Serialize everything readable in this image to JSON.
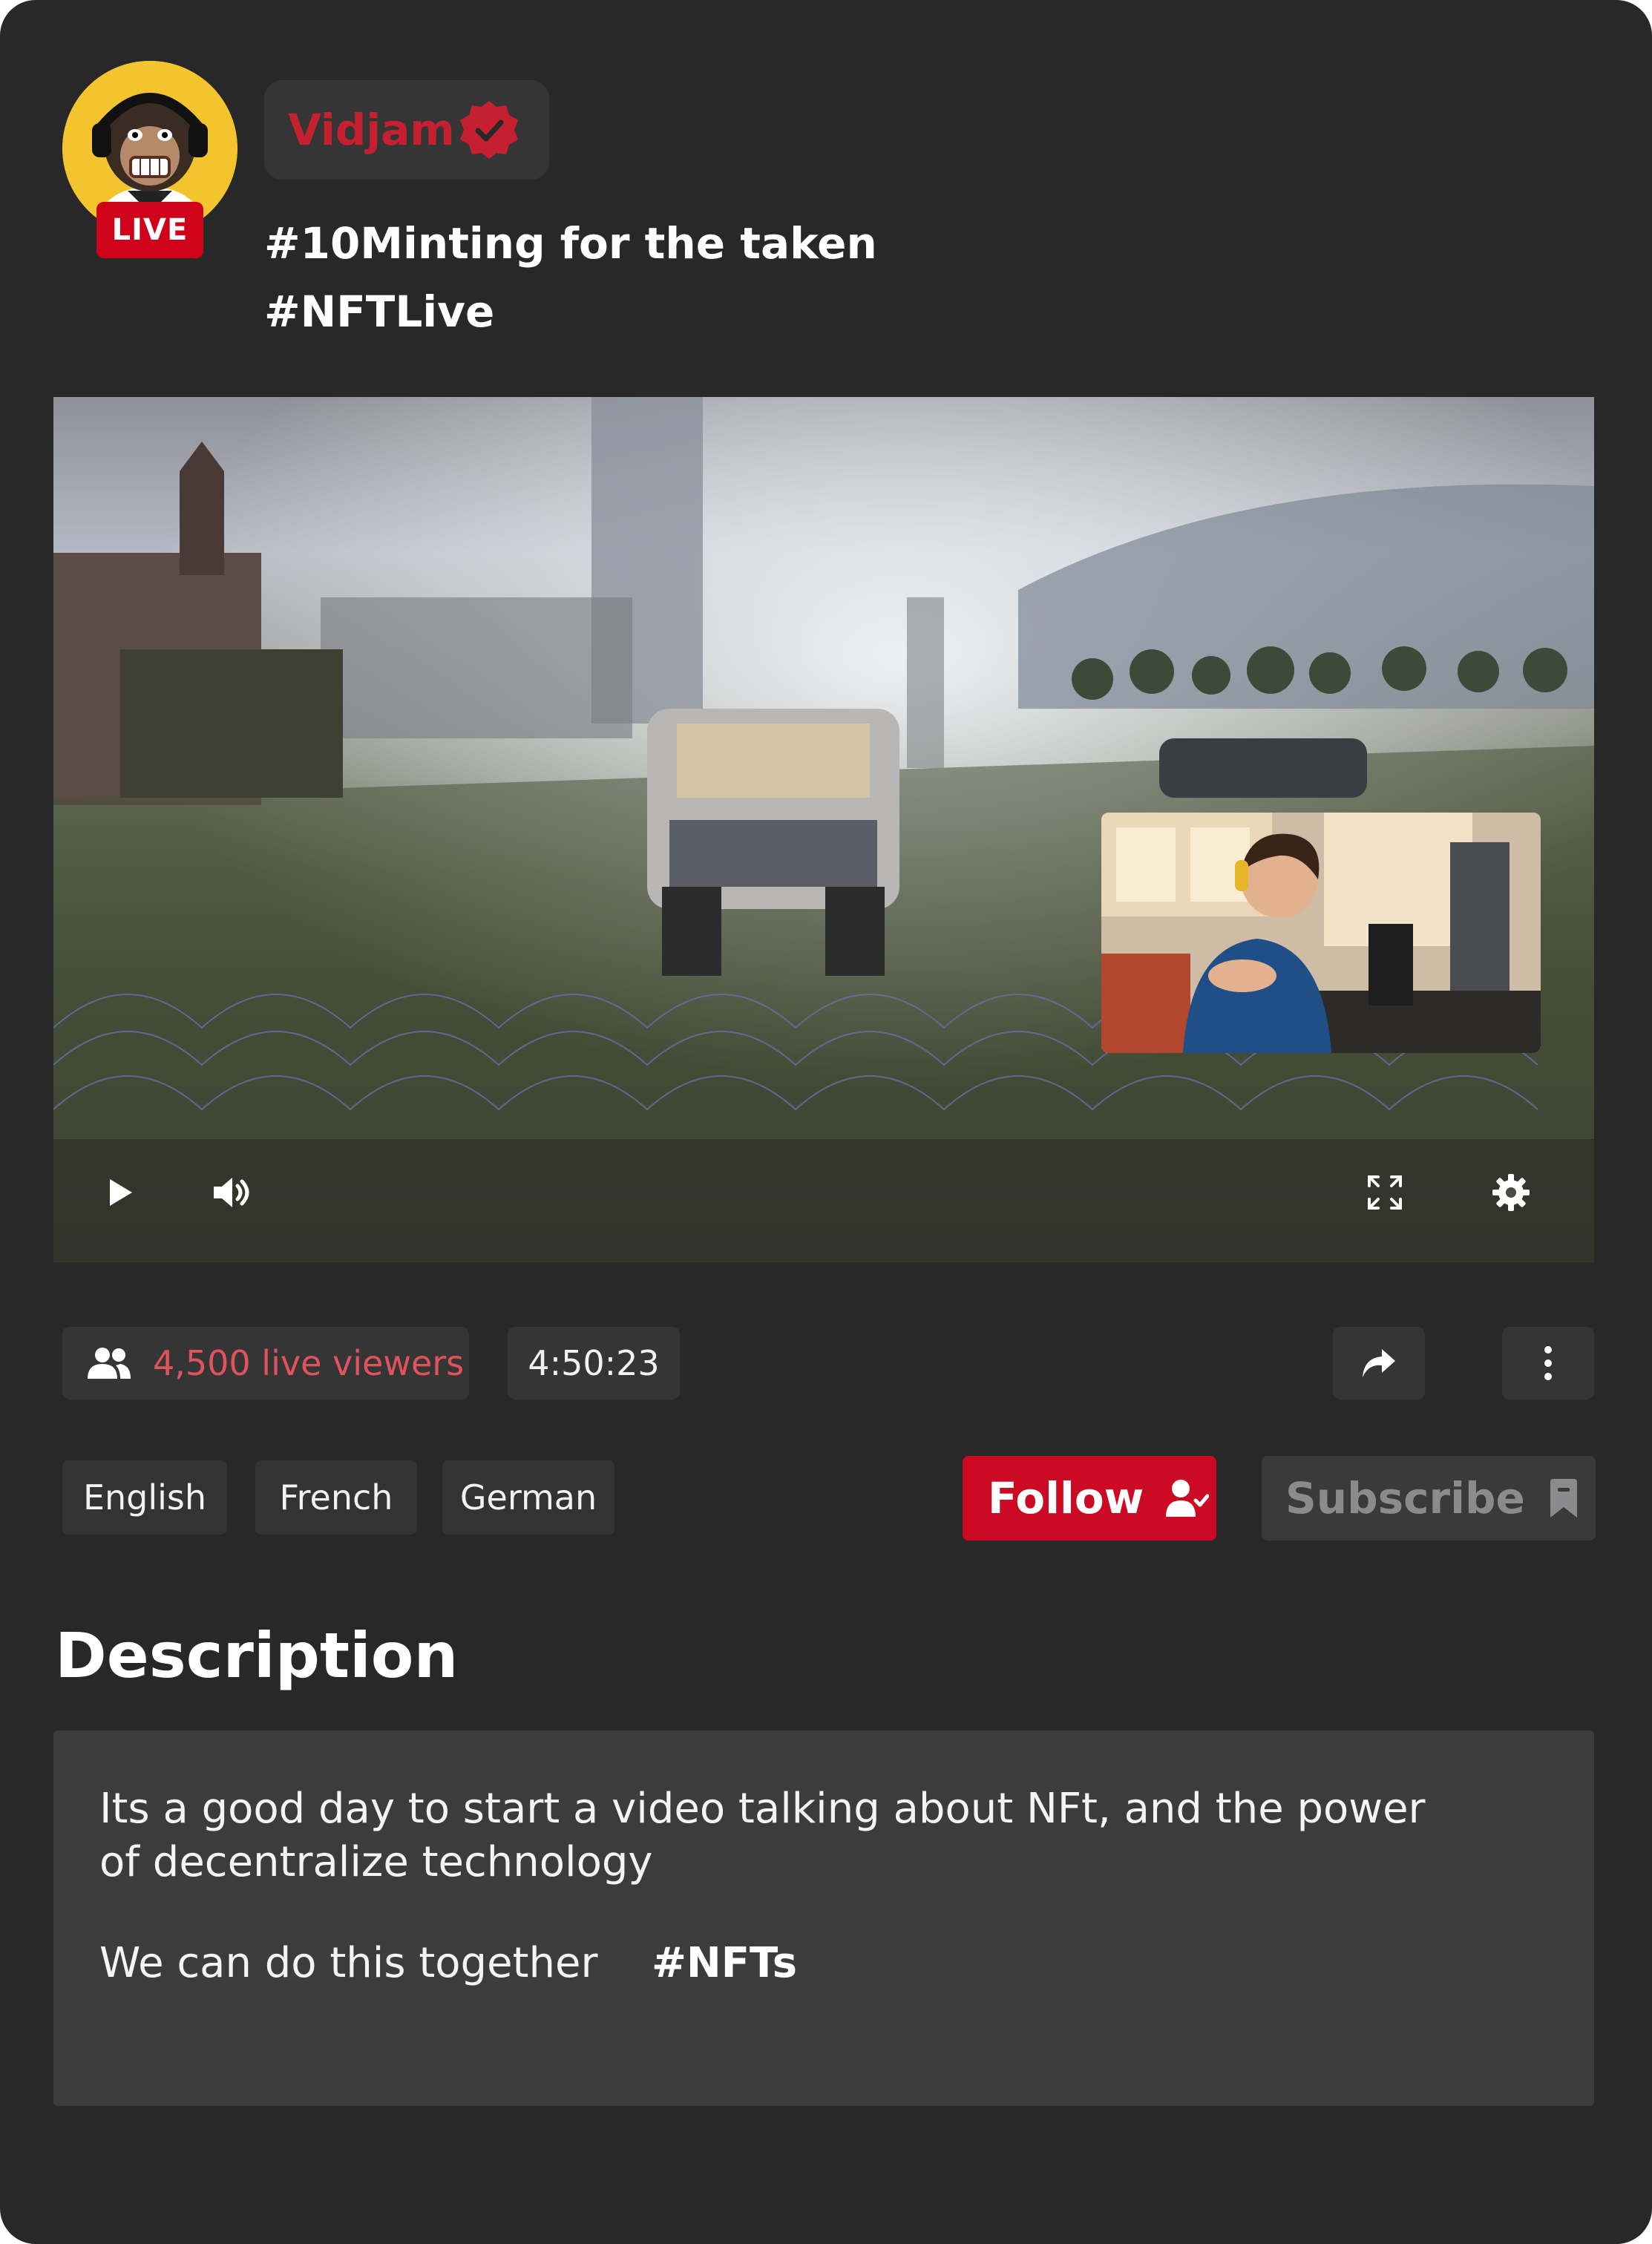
{
  "channel": {
    "name": "Vidjam",
    "live_label": "LIVE",
    "title_line1": "#10Minting for the taken",
    "title_line2": "#NFTLive"
  },
  "stats": {
    "viewers": "4,500 live viewers",
    "duration": "4:50:23"
  },
  "languages": [
    "English",
    "French",
    "German"
  ],
  "actions": {
    "follow": "Follow",
    "subscribe": "Subscribe"
  },
  "description": {
    "heading": "Description",
    "paragraph1": "Its a good day to start a video talking about NFt, and the power of decentralize technology",
    "paragraph2": "We can do this together",
    "hashtag": "#NFTs"
  },
  "colors": {
    "background": "#282829",
    "accent": "#cc0a23",
    "viewers_text": "#e0535d",
    "pill": "#353536"
  }
}
